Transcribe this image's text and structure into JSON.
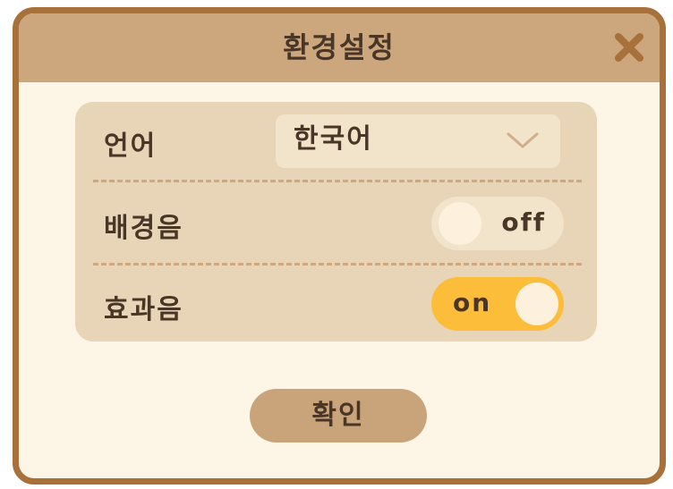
{
  "dialog": {
    "title": "환경설정",
    "close_icon": "close-icon"
  },
  "settings": {
    "language": {
      "label": "언어",
      "selected": "한국어",
      "icon": "chevron-down-icon"
    },
    "bgm": {
      "label": "배경음",
      "state": "off"
    },
    "sfx": {
      "label": "효과음",
      "state": "on"
    }
  },
  "confirm": {
    "label": "확인"
  },
  "colors": {
    "border": "#a8703a",
    "header": "#cca77e",
    "background": "#fdf6e6",
    "panel": "#e8d5b8",
    "toggle_on": "#fbbd3a",
    "text": "#4a3626"
  }
}
